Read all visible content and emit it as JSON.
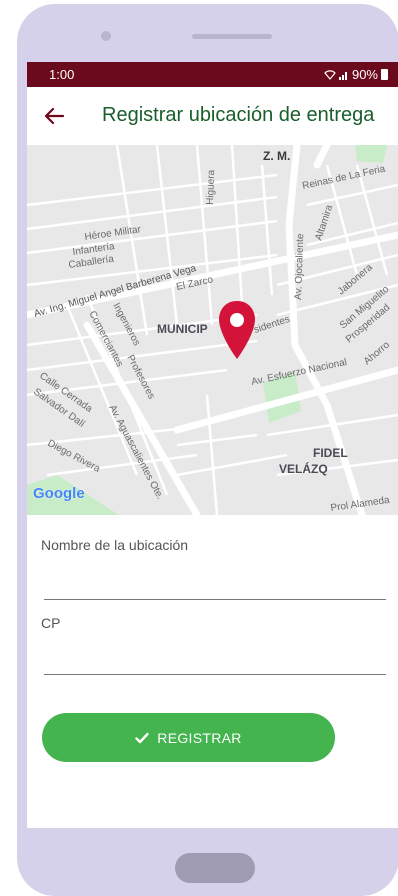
{
  "status": {
    "time": "1:00",
    "battery": "90%"
  },
  "appbar": {
    "title": "Registrar ubicación de entrega",
    "back_icon": "arrow-left-icon"
  },
  "map": {
    "attribution": "Google",
    "labels": {
      "zm": "Z. M.",
      "higuera": "Higuera",
      "reinas": "Reinas de La Feria",
      "heroe": "Héroe Militar",
      "infanteria": "Infantería",
      "caballeria": "Caballería",
      "altamira": "Altamira",
      "ojocaliente": "Av. Ojocaliente",
      "barberena": "Av. Ing. Miguel Angel Barberena Vega",
      "zarco": "El Zarco",
      "jabonera": "Jabonera",
      "comerciantes": "Comerciantes",
      "ingenieros": "Ingenieros",
      "profesores": "Profesores",
      "municipio1": "MUNICIP",
      "municipio2": "LIBRE",
      "presidentes": "sidentes",
      "san_miguelito": "San Miguelito",
      "prosperidad": "Prosperidad",
      "ahorro": "Ahorro",
      "esfuerzo": "Av. Esfuerzo Nacional",
      "calle_cerrada": "Calle Cerrada",
      "salvador_dali": "Salvador Dalí",
      "diego_rivera": "Diego Rivera",
      "aguascalientes": "Av. Aguascalientes Ote.",
      "fidel": "FIDEL",
      "velazquez": "VELÁZQ",
      "prol": "Prol Alameda"
    },
    "pin_color": "#d4133a",
    "fab_icon": "location-pin-icon"
  },
  "form": {
    "name_label": "Nombre de la ubicación",
    "name_value": "",
    "cp_label": "CP",
    "cp_value": ""
  },
  "submit": {
    "label": "REGISTRAR",
    "icon": "check-icon"
  },
  "colors": {
    "status_bar": "#6b0a1c",
    "title": "#1a5e2c",
    "button": "#44b44f",
    "phone_frame": "#d6d1ea"
  }
}
